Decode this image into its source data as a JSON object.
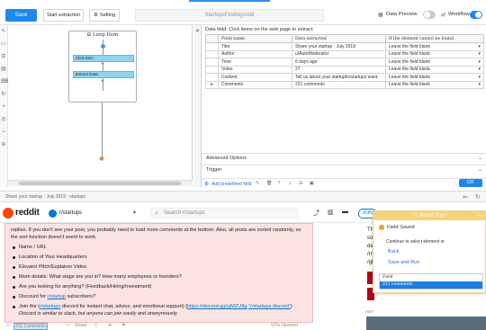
{
  "toolbar": {
    "save_label": "Save",
    "start_extraction_label": "Start extraction",
    "setting_label": "Setting",
    "task_name": "StartupsFindingsrobl",
    "data_preview_label": "Data Preview",
    "workflow_label": "Workflow",
    "data_preview_on": false,
    "workflow_on": true
  },
  "workflow": {
    "loop_title": "Loop Item",
    "nodes": [
      "Click Item",
      "Extract Data"
    ]
  },
  "data_panel": {
    "title": "Data field: Click items on the web page to extract.",
    "columns": [
      "Field name",
      "Data extracted",
      "If the element cannot be found"
    ],
    "rows": [
      {
        "field": "Title",
        "value": "Share your startup - July 2019",
        "fallback": "Leave the field blank"
      },
      {
        "field": "Author",
        "value": "u/AutoModerator",
        "fallback": "Leave the field blank"
      },
      {
        "field": "Time",
        "value": "6 days ago",
        "fallback": "Leave the field blank"
      },
      {
        "field": "Votes",
        "value": "27",
        "fallback": "Leave the field blank"
      },
      {
        "field": "Content",
        "value": "Tell us about your startupIn/startups want.",
        "fallback": "Leave the field blank"
      },
      {
        "field": "Comments",
        "value": "221 comments",
        "fallback": "Leave the field blank"
      }
    ],
    "advanced_options_label": "Advanced Options",
    "trigger_label": "Trigger",
    "add_predefined_label": "Add predefined field",
    "ok_label": "OK"
  },
  "browser": {
    "tab_title": "Share your startup - July 2019 : startups"
  },
  "reddit": {
    "brand": "reddit",
    "subreddit": "r/startups",
    "search_placeholder": "Search r/startups",
    "join_label": "JOIN",
    "intro": "replies. If you don't see your post, you probably need to load more comments at the bottom. Also, all posts are sorted randomly, so the sort function doesn't seem to work.",
    "bullets": [
      "Name / URL",
      "Location of Your Headquarters",
      "Elevator Pitch/Explainer Video",
      "More details: What stage are you in? How many employees or founders?",
      "Are you looking for anything? (Feedback/Hiring/Investment)",
      "Discount for r/startup subscribers?"
    ],
    "discount_link": "r/startup",
    "join_line_prefix": "Join the (",
    "join_line_link1": "r/startups",
    "join_line_mid": " discord for instant chat, advice, and emotional support) [",
    "join_line_link2": "https://discord.gg/yjMZU8g",
    "join_line_link3": "\"r/startups discord\"",
    "join_line_suffix": ") Discord is similar to slack, but anyone can join easily and anonymously.",
    "comments_count": "221 Comments",
    "share_label": "Share",
    "upvoted": "91% Upvoted"
  },
  "sidebar_partial": {
    "lines": [
      "The",
      "soli",
      "des",
      "/r/s",
      "/gR"
    ],
    "ads_label": "ADV"
  },
  "action_tips": {
    "header": "Action Tips",
    "status": "Field Saved",
    "message": "Continue to select element or",
    "options": [
      "Back",
      "Save and Run"
    ],
    "list_header": "Field",
    "list_selected": "221 comments"
  }
}
